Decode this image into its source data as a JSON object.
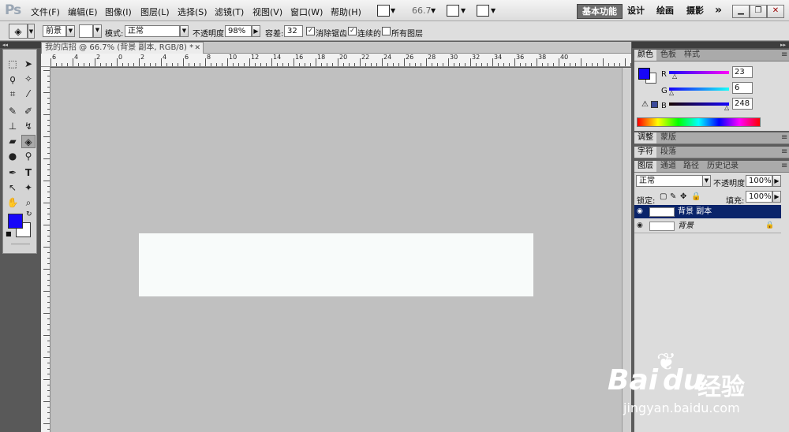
{
  "app": {
    "logo": "Ps"
  },
  "menu": [
    "文件(F)",
    "编辑(E)",
    "图像(I)",
    "图层(L)",
    "选择(S)",
    "滤镜(T)",
    "视图(V)",
    "窗口(W)",
    "帮助(H)"
  ],
  "menubar": {
    "zoom": "66.7",
    "workspace_active": "基本功能",
    "workspace_items": [
      "设计",
      "绘画",
      "摄影"
    ],
    "more": "»"
  },
  "options": {
    "fill_source": "前景",
    "mode_label": "模式:",
    "mode_value": "正常",
    "opacity_label": "不透明度:",
    "opacity_value": "98%",
    "tolerance_label": "容差:",
    "tolerance_value": "32",
    "antialias_label": "消除锯齿",
    "contiguous_label": "连续的",
    "all_layers_label": "所有图层"
  },
  "document": {
    "tab_title": "我的店招 @ 66.7% (背景 副本, RGB/8) *",
    "close": "✕"
  },
  "ruler": {
    "top_labels": [
      "6",
      "4",
      "2",
      "0",
      "2",
      "4",
      "6",
      "8",
      "10",
      "12",
      "14",
      "16",
      "18",
      "20",
      "22",
      "24",
      "26",
      "28",
      "30",
      "32",
      "34",
      "36",
      "38",
      "40"
    ]
  },
  "panels": {
    "color_tabs": [
      "颜色",
      "色板",
      "样式"
    ],
    "color": {
      "r_label": "R",
      "g_label": "G",
      "b_label": "B",
      "r": "23",
      "g": "6",
      "b": "248",
      "fg": "#1706f8"
    },
    "adjust_tabs": [
      "调整",
      "蒙版"
    ],
    "char_tabs": [
      "字符",
      "段落"
    ],
    "layer_tabs": [
      "图层",
      "通道",
      "路径",
      "历史记录"
    ],
    "layers": {
      "blend_mode": "正常",
      "opacity_label": "不透明度:",
      "opacity_value": "100%",
      "lock_label": "锁定:",
      "fill_label": "填充:",
      "fill_value": "100%",
      "items": [
        {
          "name": "背景 副本",
          "selected": true
        },
        {
          "name": "背景",
          "selected": false
        }
      ]
    }
  },
  "watermark": {
    "brand": "Bai",
    "brand2": "du",
    "cn": "经验",
    "url": "jingyan.baidu.com"
  }
}
